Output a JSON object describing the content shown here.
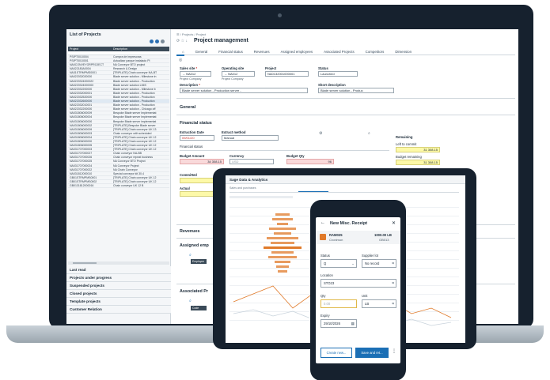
{
  "list_panel": {
    "title": "List of Projects",
    "columns": [
      "Project",
      "Description"
    ],
    "rows": [
      [
        "PSIPT0010004",
        "Compra de impresoras"
      ],
      [
        "PSIPT0010001",
        "Actualizar parque instalado PI"
      ],
      [
        "NA0CONVEYORPROJECT",
        "NA Conveyor BTO project"
      ],
      [
        "NA022180A0004",
        "Research & Design"
      ],
      [
        "NA31STRMPMS0001",
        "[TRIPLATE] Chain conveyor NA-BT"
      ],
      [
        "NA022032020000",
        "Blade server solution - Milestone in"
      ],
      [
        "NA0220324000022",
        "Blade server solution - Production"
      ],
      [
        "NA0220324000000",
        "Blade server solution LMIS"
      ],
      [
        "NA022032200000",
        "Blade server solution - Milestone b"
      ],
      [
        "NA022032000001",
        "Blade server solution - Production"
      ],
      [
        "NA022032520000",
        "Blade server solution - Production"
      ],
      [
        "NA022032600000",
        "Blade server solution - Production"
      ],
      [
        "NA022032010001",
        "Blade server solution - Production"
      ],
      [
        "NA022032200000",
        "Blade server solution - Chicago off"
      ],
      [
        "NA031806000009",
        "Bespoke Blade server Implementat"
      ],
      [
        "NA031806000004",
        "Bespoke Blade server Implementat"
      ],
      [
        "NA031806000000",
        "Bespoke Blade server implementat"
      ],
      [
        "NA031806000002",
        "[TRIPLATE] Bespoke Blade server"
      ],
      [
        "NA031806000009",
        "[TRIPLATE] Chain conveyor UK 13"
      ],
      [
        "NA031806000003",
        "Chain conveyor with scheduled"
      ],
      [
        "NA031806000004",
        "[TRIPLATE] Chain conveyor UK 12"
      ],
      [
        "NA031806000000",
        "[TRIPLATE] Chain conveyor UK 12"
      ],
      [
        "NA031806000005",
        "[TRIPLATE] Chain conveyor UK 12"
      ],
      [
        "NA031707000003",
        "[TRIPLATE] Chain conveyor UK 12"
      ],
      [
        "NA031707000027",
        "Chain conveyor NA-BB"
      ],
      [
        "NA031707000026",
        "Chain conveyor repeat business"
      ],
      [
        "NA031707000025",
        "NA Conveyor BTO Project"
      ],
      [
        "NA031707000024",
        "NA Conveyor Project"
      ],
      [
        "NA031707000022",
        "NA Chain Conveyor"
      ],
      [
        "NA031812000010",
        "Special conveyor kit 30.4"
      ],
      [
        "GB01STRMPMS0001",
        "[TRIPLATE] Chain conveyor UK 12"
      ],
      [
        "GB01STRMPMS0002",
        "[TRIPLATE] Chain conveyor UK 12"
      ],
      [
        "GB0131812000016",
        "Chain conveyor UK 12 B"
      ]
    ],
    "sections": [
      "Last read",
      "Projects under progress",
      "Suspended projects",
      "Closed projects",
      "Template projects",
      "Customer Relation"
    ]
  },
  "main": {
    "breadcrumb": "☰ / Projects / Project",
    "title": "Project management",
    "tabs": [
      "General",
      "Financial status",
      "Revenues",
      "Assigned employees",
      "Associated Projects",
      "Competitors",
      "Dimension"
    ],
    "fields": {
      "sales_site_label": "Sales site",
      "sales_site_value": "NA012",
      "sales_site_sub": "Project Company",
      "operating_site_label": "Operating site",
      "operating_site_value": "NA012",
      "operating_site_sub": "Project Company",
      "project_label": "Project",
      "project_value": "NA0132001000001",
      "status_label": "Status",
      "status_value": "Launched",
      "description_label": "Description",
      "description_value": "Blade server solution - Production server -",
      "short_description_label": "Short description",
      "short_description_value": "Blade server solution - Produc"
    },
    "general_heading": "General",
    "financial": {
      "heading": "Financial status",
      "extraction_date_label": "Extraction Date",
      "extraction_date_value": "09/01/20",
      "extract_method_label": "Extract method",
      "extract_method_value": "Manual",
      "financial_status_sub": "Financial status",
      "budget_amount_label": "Budget Amount",
      "budget_amount_value": "34 308.15",
      "currency_label": "Currency",
      "currency_value": "USD",
      "budget_qty_label": "Budget Qty",
      "budget_qty_value": "96",
      "committed_label": "Committed",
      "actual_label": "Actual",
      "remaining_label": "Remaining",
      "left_to_commit_label": "Left to commit",
      "left_to_commit_value": "31 308.15",
      "budget_remaining_label": "Budget remaining",
      "budget_remaining_value": "31 308.15"
    },
    "revenues_heading": "Revenues",
    "assigned_heading": "Assigned emp",
    "associated_heading": "Associated Pr",
    "employee_col": "Employee",
    "code_col": "Code"
  },
  "tablet": {
    "title": "Sage Data & Analytics",
    "subtitle": "Sales and purchases"
  },
  "phone": {
    "title": "New Misc. Receipt",
    "product_code": "RAM025",
    "product_name": "Cronimon",
    "product_qty": "1000.00 LB",
    "product_site": "GB013",
    "status_label": "Status",
    "status_value": "Q",
    "supplier_lot_label": "Supplier lot",
    "supplier_lot_value": "No record",
    "location_label": "Location",
    "location_value": "STO23",
    "qty_label": "Qty",
    "qty_value": "0.00",
    "unit_label": "Unit",
    "unit_value": "LB",
    "expiry_label": "Expiry",
    "expiry_value": "29/10/2026",
    "create_new_label": "Create new...",
    "save_label": "Save and ret..."
  },
  "colors": {
    "accent": "#1b6fb5",
    "device_frame": "#16212e",
    "chart_orange": "#e07a2a",
    "highlight_yellow": "#fdf9a8",
    "alert_pink": "#f9d9da"
  }
}
